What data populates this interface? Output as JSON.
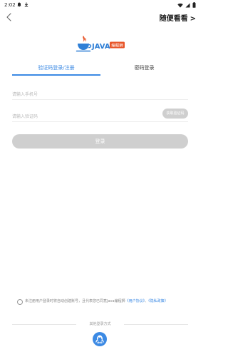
{
  "status_bar": {
    "time": "2:02"
  },
  "header": {
    "browse_label": "随便看看",
    "browse_arrow": ">"
  },
  "logo": {
    "text": "JAVA",
    "badge": "编程狮"
  },
  "tabs": [
    {
      "label": "验证码登录/注册",
      "active": true
    },
    {
      "label": "密码登录",
      "active": false
    }
  ],
  "form": {
    "phone_placeholder": "请输入手机号",
    "code_placeholder": "请输入验证码",
    "get_code_label": "获取验证码",
    "login_label": "登录"
  },
  "agreement": {
    "prefix": "未注册用户登录时将自动创建账号，且代表您已同意Java编程狮",
    "user_agreement": "《用户协议》",
    "separator": "、",
    "privacy_policy": "《隐私政策》"
  },
  "other_login": {
    "label": "其他登录方式"
  },
  "colors": {
    "accent": "#3c8ae4",
    "disabled_button": "#cfcfcf"
  }
}
